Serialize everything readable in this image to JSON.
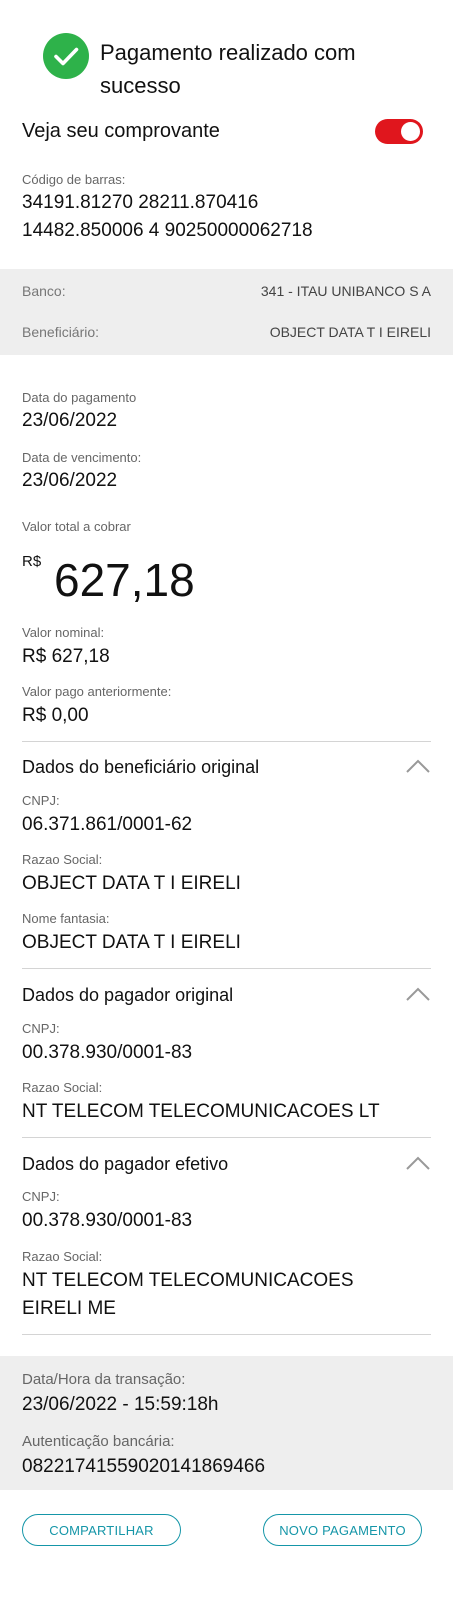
{
  "header": {
    "title": "Pagamento realizado com sucesso",
    "title_line1": "Pagamento realizado com",
    "title_line2": "sucesso",
    "status_color": "#2eb24a",
    "status_icon": "check-circle-icon"
  },
  "receipt_toggle": {
    "label": "Veja seu comprovante",
    "on": true,
    "color": "#e0161d"
  },
  "barcode": {
    "label": "Código de barras:",
    "line1": "34191.81270 28211.870416",
    "line2": "14482.850006 4 90250000062718"
  },
  "bank_info": {
    "bank_label": "Banco:",
    "bank_value": "341 - ITAU UNIBANCO S A",
    "beneficiary_label": "Beneficiário:",
    "beneficiary_value": "OBJECT DATA T I EIRELI"
  },
  "payment": {
    "payment_date_label": "Data do pagamento",
    "payment_date": "23/06/2022",
    "due_date_label": "Data de vencimento:",
    "due_date": "23/06/2022",
    "total_label": "Valor total a cobrar",
    "currency": "R$",
    "total_value": "627,18",
    "nominal_label": "Valor nominal:",
    "nominal_value": "R$ 627,18",
    "previous_label": "Valor pago anteriormente:",
    "previous_value": "R$ 0,00"
  },
  "original_beneficiary": {
    "title": "Dados do beneficiário original",
    "cnpj_label": "CNPJ:",
    "cnpj": "06.371.861/0001-62",
    "razao_label": "Razao Social:",
    "razao": "OBJECT DATA T I EIRELI",
    "fantasia_label": "Nome fantasia:",
    "fantasia": "OBJECT DATA T I EIRELI"
  },
  "original_payer": {
    "title": "Dados do pagador original",
    "cnpj_label": "CNPJ:",
    "cnpj": "00.378.930/0001-83",
    "razao_label": "Razao Social:",
    "razao": "NT TELECOM TELECOMUNICACOES LT"
  },
  "effective_payer": {
    "title": "Dados do pagador efetivo",
    "cnpj_label": "CNPJ:",
    "cnpj": "00.378.930/0001-83",
    "razao_label": "Razao Social:",
    "razao_line1": "NT TELECOM TELECOMUNICACOES",
    "razao_line2": "EIRELI ME"
  },
  "transaction": {
    "datetime_label": "Data/Hora da transação:",
    "datetime": "23/06/2022 - 15:59:18h",
    "auth_label": "Autenticação bancária:",
    "auth": "08221741559020141869466"
  },
  "actions": {
    "share_label": "COMPARTILHAR",
    "new_payment_label": "NOVO PAGAMENTO",
    "accent_color": "#1596a8"
  }
}
